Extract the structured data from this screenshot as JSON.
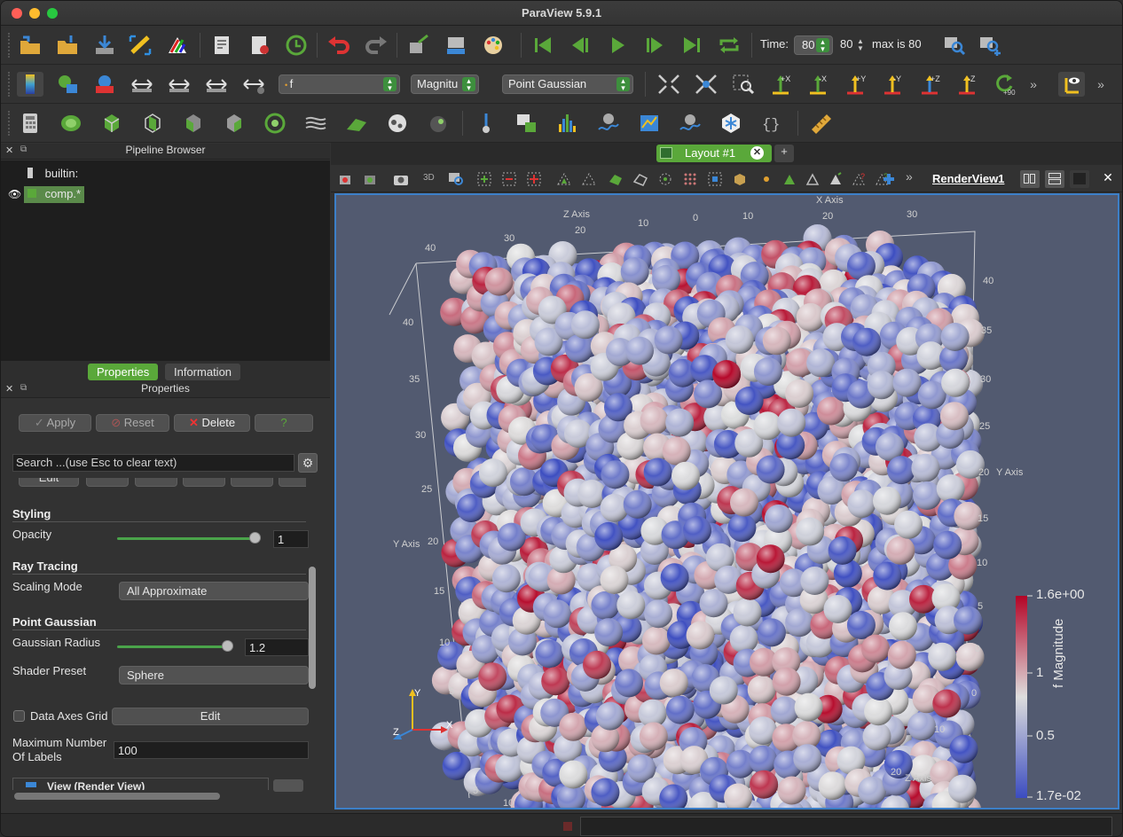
{
  "app": {
    "title": "ParaView 5.9.1"
  },
  "time": {
    "label": "Time:",
    "value": "80",
    "index": "80",
    "max_text": "max is 80"
  },
  "toolbar2": {
    "array_combo": "f",
    "component_combo": "Magnitu",
    "representation_combo": "Point Gaussian",
    "cam_buttons": [
      "+X",
      "-X",
      "+Y",
      "-Y",
      "+Z",
      "-Z",
      "+90"
    ]
  },
  "pipeline": {
    "header": "Pipeline Browser",
    "items": [
      {
        "label": "builtin:"
      },
      {
        "label": "comp.*"
      }
    ]
  },
  "panel_tabs": {
    "properties": "Properties",
    "information": "Information"
  },
  "properties": {
    "header": "Properties",
    "apply": "Apply",
    "reset": "Reset",
    "delete": "Delete",
    "help": "?",
    "search_placeholder": "Search ...(use Esc to clear text)",
    "partial_button": "Edit",
    "styling_title": "Styling",
    "opacity_label": "Opacity",
    "opacity_value": "1",
    "opacity_fraction": 1.0,
    "ray_title": "Ray Tracing",
    "scaling_label": "Scaling Mode",
    "scaling_value": "All Approximate",
    "pg_title": "Point Gaussian",
    "radius_label": "Gaussian Radius",
    "radius_value": "1.2",
    "shader_label": "Shader Preset",
    "shader_value": "Sphere",
    "axes_grid_label": "Data Axes Grid",
    "axes_grid_edit": "Edit",
    "max_labels_label1": "Maximum Number",
    "max_labels_label2": "Of Labels",
    "max_labels_value": "100",
    "view_section": "View (Render View)"
  },
  "layout": {
    "tab_label": "Layout #1",
    "add_tab": "+",
    "view_name": "RenderView1"
  },
  "render": {
    "axes": {
      "x_title": "X Axis",
      "y_title_left": "Y Axis",
      "y_title_right": "Y Axis",
      "z_title_top": "Z Axis",
      "z_title_right": "Z Axis",
      "x_ticks": [
        "0",
        "10",
        "20",
        "30"
      ],
      "z_ticks_top": [
        "40",
        "30",
        "20",
        "10"
      ],
      "y_ticks_left": [
        "40",
        "35",
        "30",
        "25",
        "20",
        "15",
        "10",
        "5"
      ],
      "y_ticks_right": [
        "40",
        "35",
        "30",
        "25",
        "20",
        "15",
        "10",
        "5",
        "0"
      ],
      "z_ticks_right": [
        "0",
        "10",
        "20"
      ],
      "bottom_ticks": [
        "5",
        "10"
      ]
    },
    "orientation": {
      "x": "X",
      "y": "Y",
      "z": "Z"
    },
    "colorbar": {
      "title": "f Magnitude",
      "max": "1.6e+00",
      "mid1": "1",
      "mid2": "0.5",
      "min": "1.7e-02",
      "color_high": "#b40426",
      "color_mid": "#dddddd",
      "color_low": "#3b4cc0"
    },
    "background": "#525a70"
  }
}
